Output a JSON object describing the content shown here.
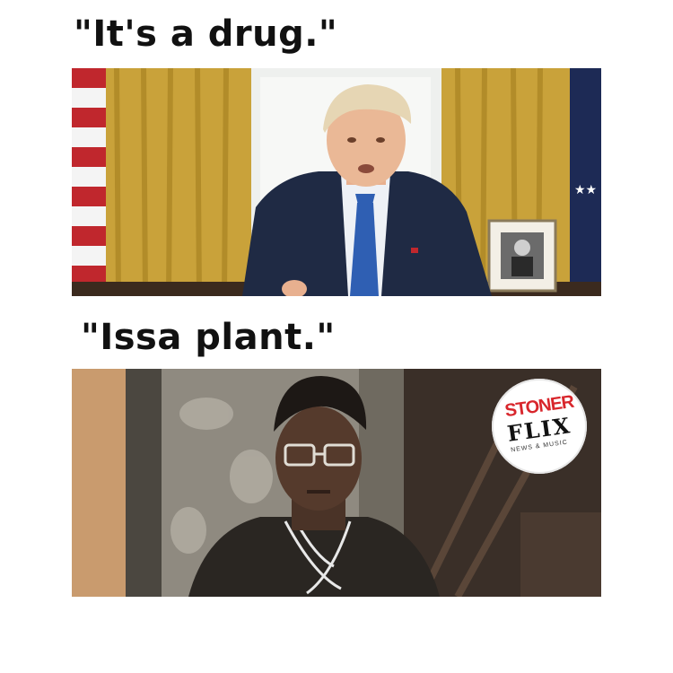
{
  "captions": {
    "top": "\"It's a drug.\"",
    "bottom": "\"Issa plant.\""
  },
  "watermark": {
    "line1": "STONER",
    "line2": "FLIX",
    "line3": "NEWS & MUSIC"
  },
  "colors": {
    "background": "#ffffff",
    "caption_text": "#111111",
    "curtain_gold": "#c9a23a",
    "flag_red": "#c0272d",
    "suit_navy": "#1f2a44",
    "tie_blue": "#2f5fb3",
    "logo_red": "#d8262c"
  }
}
